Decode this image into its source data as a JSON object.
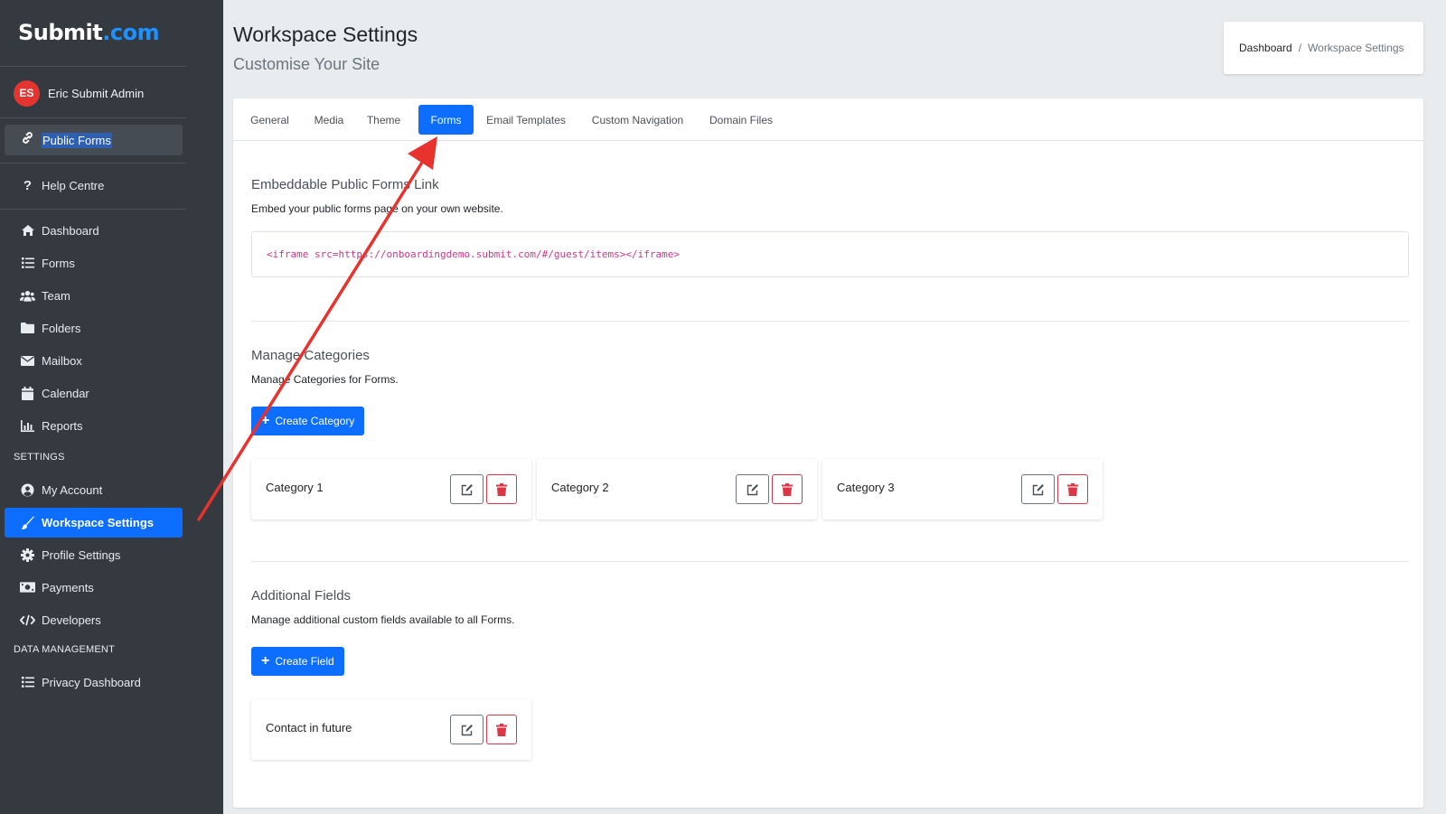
{
  "brand": {
    "logo_part1": "Submit",
    "logo_part2": ".com"
  },
  "user": {
    "initials": "ES",
    "name": "Eric Submit Admin"
  },
  "sidebar": {
    "public_forms": "Public Forms",
    "help_centre": "Help Centre",
    "main_items": [
      {
        "label": "Dashboard",
        "icon": "home-icon"
      },
      {
        "label": "Forms",
        "icon": "list-icon"
      },
      {
        "label": "Team",
        "icon": "users-icon"
      },
      {
        "label": "Folders",
        "icon": "folder-icon"
      },
      {
        "label": "Mailbox",
        "icon": "mail-icon"
      },
      {
        "label": "Calendar",
        "icon": "calendar-icon"
      },
      {
        "label": "Reports",
        "icon": "chart-icon"
      }
    ],
    "settings_label": "SETTINGS",
    "settings_items": [
      {
        "label": "My Account",
        "icon": "user-circle-icon"
      },
      {
        "label": "Workspace Settings",
        "icon": "brush-icon",
        "active": true
      },
      {
        "label": "Profile Settings",
        "icon": "gear-icon"
      },
      {
        "label": "Payments",
        "icon": "money-icon"
      },
      {
        "label": "Developers",
        "icon": "code-icon"
      }
    ],
    "data_label": "DATA MANAGEMENT",
    "data_items": [
      {
        "label": "Privacy Dashboard",
        "icon": "list-icon"
      }
    ]
  },
  "header": {
    "title": "Workspace Settings",
    "subtitle": "Customise Your Site",
    "breadcrumb": {
      "home": "Dashboard",
      "separator": "/",
      "current": "Workspace Settings"
    }
  },
  "tabs": [
    {
      "label": "General"
    },
    {
      "label": "Media"
    },
    {
      "label": "Theme"
    },
    {
      "label": "Forms",
      "active": true
    },
    {
      "label": "Email Templates"
    },
    {
      "label": "Custom Navigation"
    },
    {
      "label": "Domain Files"
    }
  ],
  "embed": {
    "title": "Embeddable Public Forms Link",
    "description": "Embed your public forms page on your own website.",
    "code": "<iframe src=https://onboardingdemo.submit.com/#/guest/items></iframe>"
  },
  "categories": {
    "title": "Manage Categories",
    "description": "Manage Categories for Forms.",
    "button": "Create Category",
    "items": [
      "Category 1",
      "Category 2",
      "Category 3"
    ]
  },
  "fields": {
    "title": "Additional Fields",
    "description": "Manage additional custom fields available to all Forms.",
    "button": "Create Field",
    "items": [
      "Contact in future"
    ]
  },
  "colors": {
    "sidebar_bg": "#343a40",
    "accent": "#0d6efd",
    "danger": "#dc3545",
    "annotation_arrow": "#e8322d"
  }
}
